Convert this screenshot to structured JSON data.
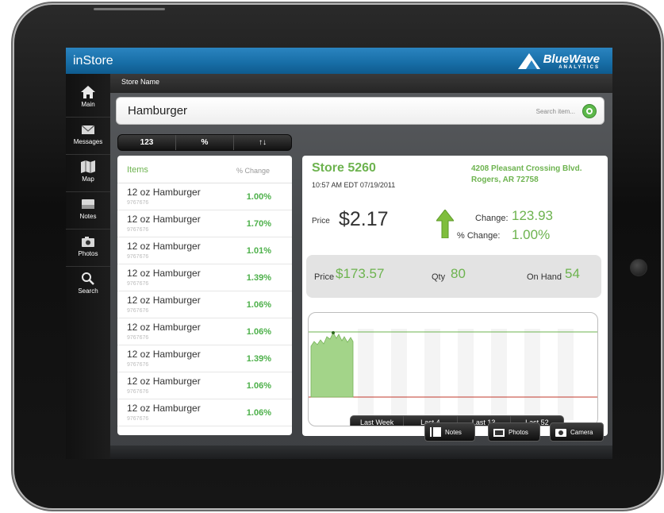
{
  "app": {
    "title": "inStore"
  },
  "brand": {
    "name": "BlueWave",
    "sub": "ANALYTICS"
  },
  "nav": [
    {
      "label": "Main",
      "icon": "home-icon"
    },
    {
      "label": "Messages",
      "icon": "mail-icon"
    },
    {
      "label": "Map",
      "icon": "map-icon"
    },
    {
      "label": "Notes",
      "icon": "notes-icon"
    },
    {
      "label": "Photos",
      "icon": "camera-icon"
    },
    {
      "label": "Search",
      "icon": "search-icon"
    }
  ],
  "store_label": "Store Name",
  "search": {
    "value": "Hamburger",
    "placeholder": "Search item..."
  },
  "segment": [
    "123",
    "%",
    "↑↓"
  ],
  "list": {
    "header_items": "Items",
    "header_change": "% Change",
    "rows": [
      {
        "name": "12 oz Hamburger",
        "sku": "9767676",
        "pct": "1.00%"
      },
      {
        "name": "12 oz Hamburger",
        "sku": "9767676",
        "pct": "1.70%"
      },
      {
        "name": "12 oz Hamburger",
        "sku": "9767676",
        "pct": "1.01%"
      },
      {
        "name": "12 oz Hamburger",
        "sku": "9767676",
        "pct": "1.39%"
      },
      {
        "name": "12 oz Hamburger",
        "sku": "9767676",
        "pct": "1.06%"
      },
      {
        "name": "12 oz Hamburger",
        "sku": "9767676",
        "pct": "1.06%"
      },
      {
        "name": "12 oz Hamburger",
        "sku": "9767676",
        "pct": "1.39%"
      },
      {
        "name": "12 oz Hamburger",
        "sku": "9767676",
        "pct": "1.06%"
      },
      {
        "name": "12 oz Hamburger",
        "sku": "9767676",
        "pct": "1.06%"
      }
    ]
  },
  "detail": {
    "store": "Store 5260",
    "time": "10:57 AM EDT 07/19/2011",
    "address1": "4208 Pleasant Crossing Blvd.",
    "address2": "Rogers, AR 72758",
    "price_label": "Price",
    "price": "$2.17",
    "change_label": "Change:",
    "change": "123.93",
    "pct_change_label": "% Change:",
    "pct_change": "1.00%",
    "total_price_label": "Price",
    "total_price": "$173.57",
    "qty_label": "Qty",
    "qty": "80",
    "on_hand_label": "On Hand",
    "on_hand": "54"
  },
  "chart_tabs": [
    "Last Week",
    "Last 4",
    "Last 13",
    "Last 52"
  ],
  "actions": {
    "notes": "Notes",
    "photos": "Photos",
    "camera": "Camera"
  },
  "colors": {
    "accent_green": "#6db34f",
    "topbar_blue": "#186fa8",
    "up_arrow": "#7fbe3c"
  }
}
